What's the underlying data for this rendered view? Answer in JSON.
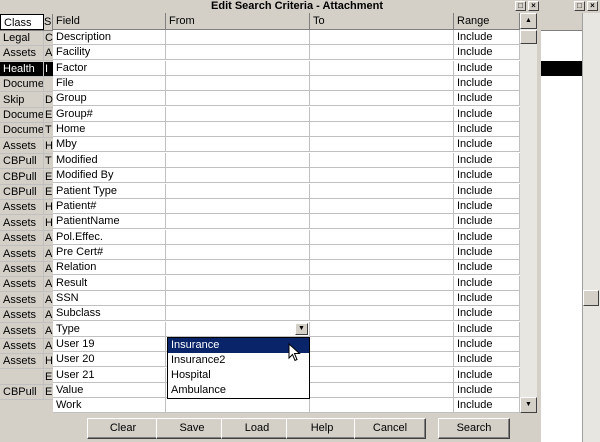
{
  "window": {
    "title": "Edit Search Criteria - Attachment"
  },
  "background_grid": {
    "headers": {
      "class": "Class",
      "s": "S"
    },
    "classes": [
      "Legal",
      "Assets",
      "Health",
      "Documer",
      "Skip",
      "Documer",
      "Documer",
      "Assets",
      "CBPull",
      "CBPull",
      "CBPull",
      "Assets",
      "Assets",
      "Assets",
      "Assets",
      "Assets",
      "Assets",
      "Assets",
      "Assets",
      "Assets",
      "Assets",
      "Assets",
      "",
      "CBPull"
    ],
    "s_values": [
      "C",
      "A",
      "I",
      "",
      "D",
      "E",
      "T",
      "H",
      "T",
      "E",
      "E",
      "H",
      "H",
      "A",
      "A",
      "A",
      "A",
      "A",
      "A",
      "A",
      "A",
      "H",
      "E",
      "E"
    ],
    "selected_row": 2
  },
  "grid": {
    "columns": {
      "field": "Field",
      "from": "From",
      "to": "To",
      "range": "Range"
    },
    "rows": [
      {
        "field": "Description",
        "range": "Include"
      },
      {
        "field": "Facility",
        "range": "Include"
      },
      {
        "field": "Factor",
        "range": "Include"
      },
      {
        "field": "File",
        "range": "Include"
      },
      {
        "field": "Group",
        "range": "Include"
      },
      {
        "field": "Group#",
        "range": "Include"
      },
      {
        "field": "Home",
        "range": "Include"
      },
      {
        "field": "Mby",
        "range": "Include"
      },
      {
        "field": "Modified",
        "range": "Include"
      },
      {
        "field": "Modified By",
        "range": "Include"
      },
      {
        "field": "Patient Type",
        "range": "Include"
      },
      {
        "field": "Patient#",
        "range": "Include"
      },
      {
        "field": "PatientName",
        "range": "Include"
      },
      {
        "field": "Pol.Effec.",
        "range": "Include"
      },
      {
        "field": "Pre Cert#",
        "range": "Include"
      },
      {
        "field": "Relation",
        "range": "Include"
      },
      {
        "field": "Result",
        "range": "Include"
      },
      {
        "field": "SSN",
        "range": "Include"
      },
      {
        "field": "Subclass",
        "range": "Include"
      },
      {
        "field": "Type",
        "range": "Include"
      },
      {
        "field": "User 19",
        "range": "Include"
      },
      {
        "field": "User 20",
        "range": "Include"
      },
      {
        "field": "User 21",
        "range": "Include"
      },
      {
        "field": "Value",
        "range": "Include"
      },
      {
        "field": "Work",
        "range": "Include"
      }
    ]
  },
  "dropdown": {
    "options": [
      "Insurance",
      "Insurance2",
      "Hospital",
      "Ambulance"
    ],
    "selected": 0
  },
  "buttons": {
    "clear": "Clear",
    "save": "Save",
    "load": "Load",
    "help": "Help",
    "cancel": "Cancel",
    "search": "Search"
  },
  "titlebar_buttons": {
    "restore": "□",
    "close": "×"
  },
  "colors": {
    "selection": "#0a246a",
    "face": "#d4d0c8"
  }
}
